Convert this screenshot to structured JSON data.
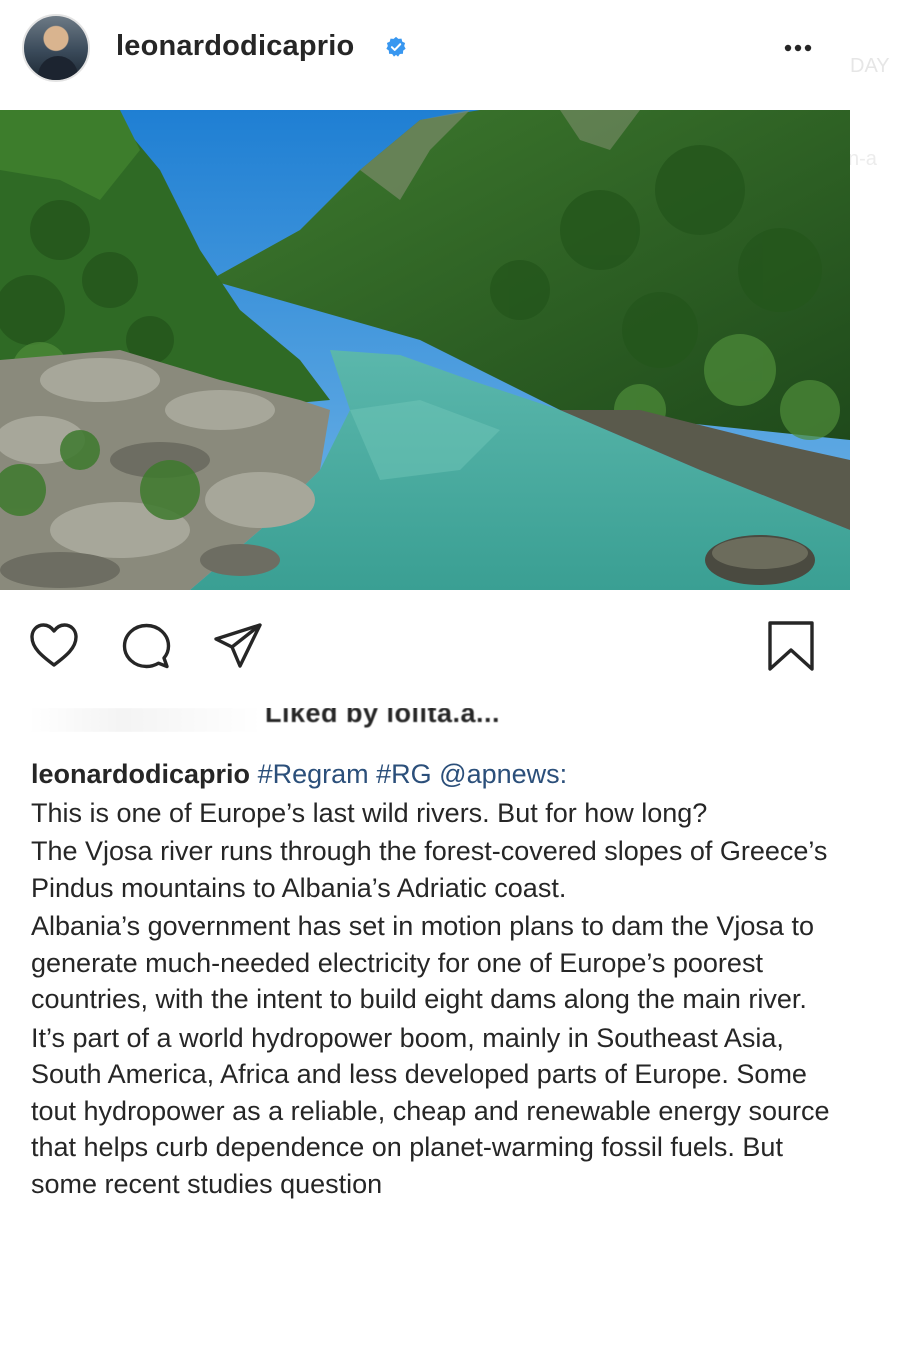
{
  "post": {
    "username": "leonardodicaprio",
    "verified": true,
    "photo_alt": "",
    "background_hint_day": "DAY",
    "background_hint_na": "n-a"
  },
  "actions": {
    "like_icon": "heart-icon",
    "comment_icon": "comment-icon",
    "share_icon": "share-icon",
    "save_icon": "bookmark-icon"
  },
  "likes": {
    "text": "Liked by lolita.a..."
  },
  "caption": {
    "username": "leonardodicaprio",
    "tags": [
      {
        "text": "#Regram"
      },
      {
        "text": "#RG"
      },
      {
        "text": "@apnews:"
      }
    ],
    "paragraphs": [
      "This is one of Europe’s last wild rivers. But for how long?",
      "The Vjosa river runs through the forest-covered slopes of Greece’s Pindus mountains to Albania’s Adriatic coast.",
      "Albania’s government has set in motion plans to dam the Vjosa to generate much-needed electricity for one of Europe’s poorest countries, with the intent to build eight dams along the main river.",
      "It’s part of a world hydropower boom, mainly in Southeast Asia, South America, Africa and less developed parts of Europe. Some tout hydropower as a reliable, cheap and renewable energy source that helps curb dependence on planet-warming fossil fuels. But some recent studies question"
    ]
  },
  "colors": {
    "text": "#262626",
    "link": "#2b4f7a",
    "verified_blue": "#3897f0"
  }
}
